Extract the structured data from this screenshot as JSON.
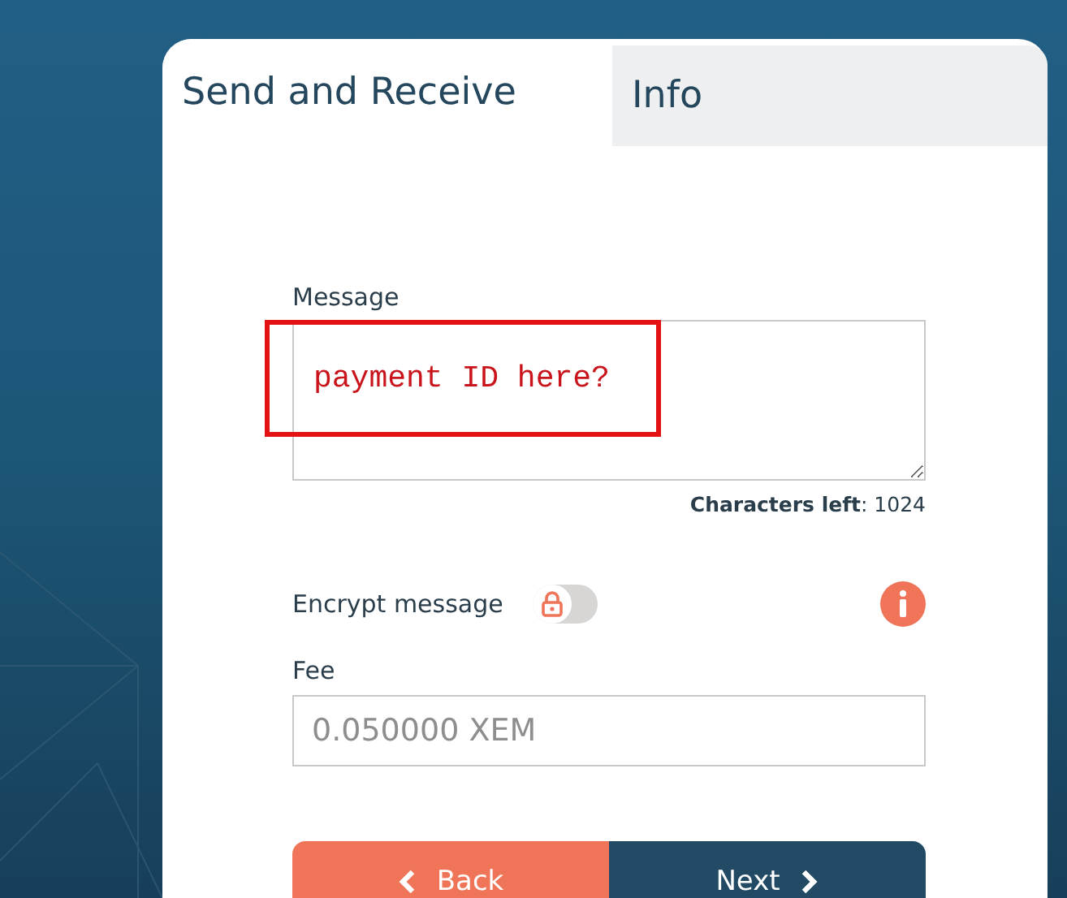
{
  "tabs": [
    {
      "label": "Send and Receive",
      "selected": true
    },
    {
      "label": "Info",
      "selected": false
    }
  ],
  "message": {
    "label": "Message",
    "characters_left": "**Characters left**: 1024"
  },
  "annotation": {
    "text": "payment ID here?"
  },
  "encrypt": {
    "label": "Encrypt message",
    "on": false
  },
  "fee": {
    "label": "Fee",
    "placeholder": "0.050000 XEM"
  },
  "buttons": [
    {
      "label": "Back",
      "kind": "back"
    },
    {
      "label": "Next",
      "kind": "next"
    }
  ]
}
